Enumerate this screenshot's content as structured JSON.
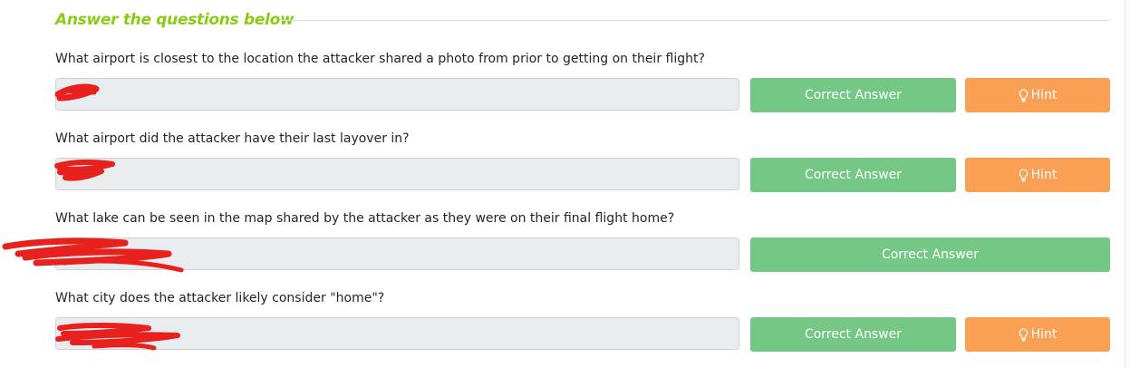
{
  "section": {
    "title": "Answer the questions below"
  },
  "questions": [
    {
      "label": "What airport is closest to the location the attacker shared a photo from prior to getting on their flight?",
      "answer": "",
      "correct_label": "Correct Answer",
      "hint_label": "Hint",
      "has_hint": true
    },
    {
      "label": "What airport did the attacker have their last layover in?",
      "answer": "",
      "correct_label": "Correct Answer",
      "hint_label": "Hint",
      "has_hint": true
    },
    {
      "label": "What lake can be seen in the map shared by the attacker as they were on their final flight home?",
      "answer": "",
      "correct_label": "Correct Answer",
      "has_hint": false
    },
    {
      "label": "What city does the attacker likely consider \"home\"?",
      "answer": "",
      "correct_label": "Correct Answer",
      "hint_label": "Hint",
      "has_hint": true
    }
  ],
  "colors": {
    "title_green": "#88cc14",
    "correct_green": "#75c785",
    "hint_orange": "#faa055",
    "redaction_red": "#e8201e"
  },
  "icons": {
    "hint": "lightbulb-icon"
  }
}
